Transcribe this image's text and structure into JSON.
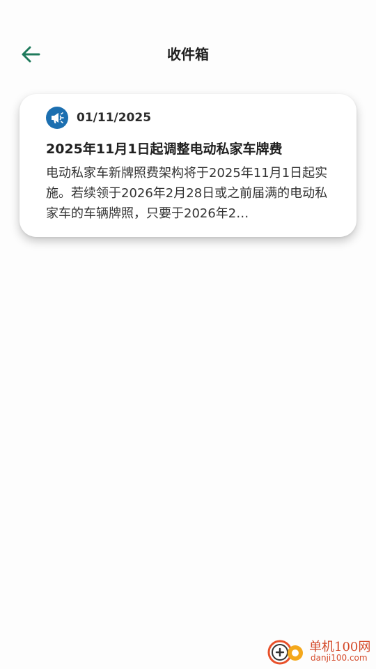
{
  "header": {
    "title": "收件箱",
    "back_icon": "arrow-left-icon",
    "back_icon_color": "#1f7a5c"
  },
  "inbox": {
    "messages": [
      {
        "icon": "megaphone-icon",
        "icon_color": "#1c6fb0",
        "date": "01/11/2025",
        "title": "2025年11月1日起调整电动私家车牌费",
        "body": "电动私家车新牌照费架构将于2025年11月1日起实施。若续领于2026年2月28日或之前届满的电动私家车的车辆牌照，只要于2026年2…"
      }
    ]
  },
  "watermark": {
    "text": "单机100网",
    "sub": "danji100.com",
    "color": "#d44a2a"
  }
}
